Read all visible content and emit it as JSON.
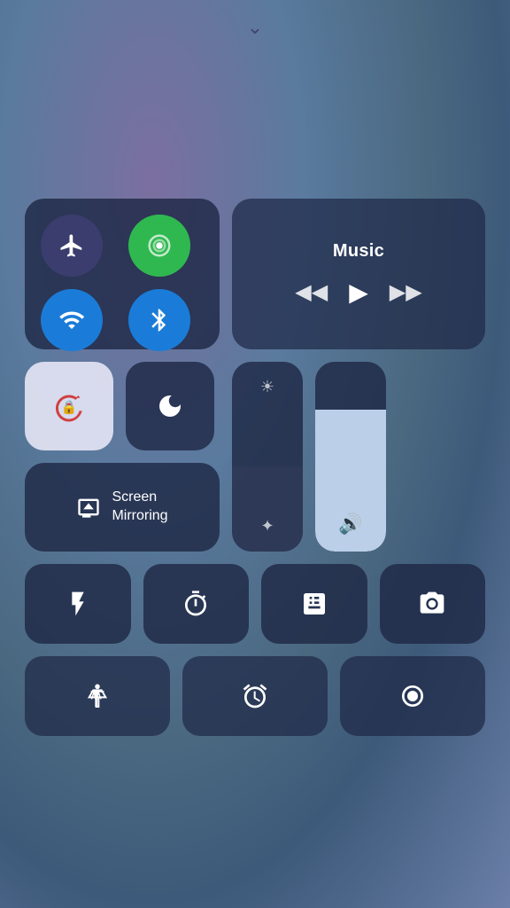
{
  "drag_indicator": "⌄",
  "connectivity": {
    "airplane_label": "Airplane Mode",
    "cellular_label": "Cellular",
    "wifi_label": "Wi-Fi",
    "bluetooth_label": "Bluetooth"
  },
  "music": {
    "title": "Music",
    "rewind_label": "⏮",
    "play_label": "▶",
    "forward_label": "⏭"
  },
  "rotation": {
    "label": "Rotation Lock"
  },
  "do_not_disturb": {
    "label": "Do Not Disturb"
  },
  "screen_mirroring": {
    "label": "Screen\nMirroring"
  },
  "brightness": {
    "label": "Brightness"
  },
  "volume": {
    "label": "Volume"
  },
  "row3": {
    "flashlight_label": "Flashlight",
    "timer_label": "Timer",
    "calculator_label": "Calculator",
    "camera_label": "Camera"
  },
  "row4": {
    "accessibility_label": "Accessibility Shortcut",
    "alarm_label": "Alarm",
    "screen_record_label": "Screen Record"
  },
  "icons": {
    "rewind": "◀◀",
    "play": "▶",
    "forward": "▶▶"
  }
}
